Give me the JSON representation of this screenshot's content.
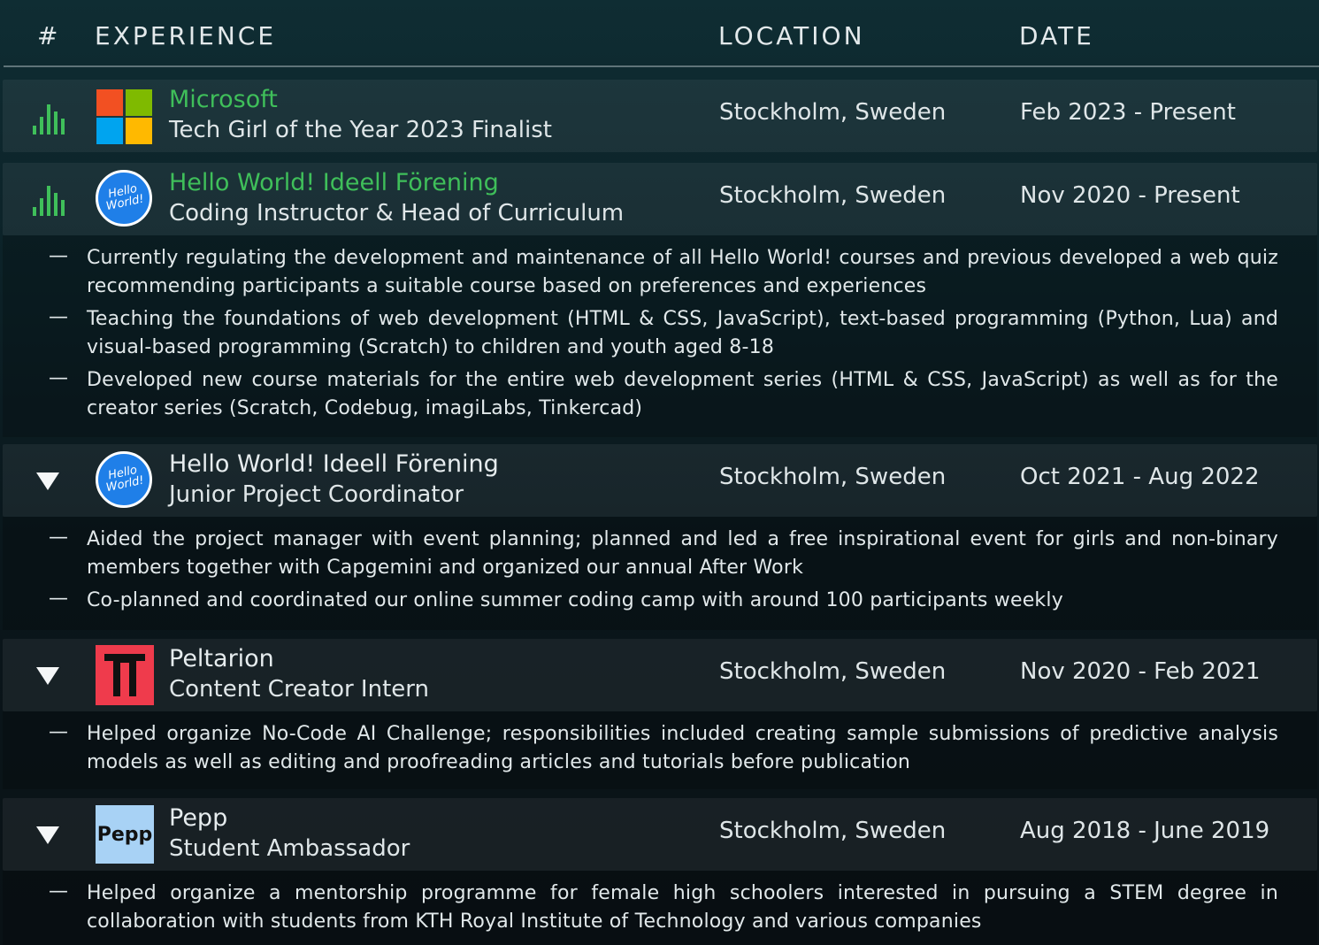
{
  "header": {
    "num": "#",
    "experience": "EXPERIENCE",
    "location": "LOCATION",
    "date": "DATE"
  },
  "colors": {
    "accent_green": "#3fbf5a",
    "hello_world_blue": "#1f7fe8",
    "peltarion_red": "#ef3b4c",
    "pepp_blue": "#a8d2f5"
  },
  "entries": [
    {
      "company": "Microsoft",
      "role": "Tech Girl of the Year 2023 Finalist",
      "location": "Stockholm, Sweden",
      "date": "Feb 2023 - Present",
      "icon": "bar-chart-icon",
      "logo": "microsoft-logo",
      "bullets": []
    },
    {
      "company": "Hello World! Ideell Förening",
      "role": "Coding Instructor & Head of Curriculum",
      "location": "Stockholm, Sweden",
      "date": "Nov 2020 - Present",
      "icon": "bar-chart-icon",
      "logo": "hello-world-logo",
      "logo_text_1": "Hello",
      "logo_text_2": "World!",
      "bullets": [
        "Currently regulating the development and maintenance of all Hello World! courses and previous developed a web quiz recommending participants a suitable course based on preferences and experiences",
        "Teaching the foundations of web development (HTML & CSS, JavaScript), text-based programming (Python, Lua) and visual-based programming (Scratch) to children and youth aged 8-18",
        "Developed new course materials for the entire web development series (HTML & CSS, JavaScript) as well as for the creator series (Scratch, Codebug, imagiLabs, Tinkercad)"
      ]
    },
    {
      "company": "Hello World! Ideell Förening",
      "role": "Junior Project Coordinator",
      "location": "Stockholm, Sweden",
      "date": "Oct 2021 - Aug 2022",
      "icon": "triangle-down-icon",
      "logo": "hello-world-logo",
      "logo_text_1": "Hello",
      "logo_text_2": "World!",
      "bullets": [
        "Aided the project manager with event planning; planned and led a free inspirational event for girls and non-binary members together with Capgemini and organized our annual After Work",
        "Co-planned and coordinated our online summer coding camp with around 100 participants weekly"
      ]
    },
    {
      "company": "Peltarion",
      "role": "Content Creator Intern",
      "location": "Stockholm, Sweden",
      "date": "Nov 2020 - Feb 2021",
      "icon": "triangle-down-icon",
      "logo": "peltarion-logo",
      "bullets": [
        "Helped organize No-Code AI Challenge; responsibilities included creating sample submissions of predictive analysis models as well as editing and proofreading articles and tutorials before publication"
      ]
    },
    {
      "company": "Pepp",
      "role": "Student Ambassador",
      "location": "Stockholm, Sweden",
      "date": "Aug 2018 - June 2019",
      "icon": "triangle-down-icon",
      "logo": "pepp-logo",
      "logo_text": "Pepp",
      "bullets": [
        "Helped organize a mentorship programme for female high schoolers interested in pursuing a STEM degree in collaboration with students from KTH Royal Institute of Technology and various companies"
      ]
    }
  ]
}
